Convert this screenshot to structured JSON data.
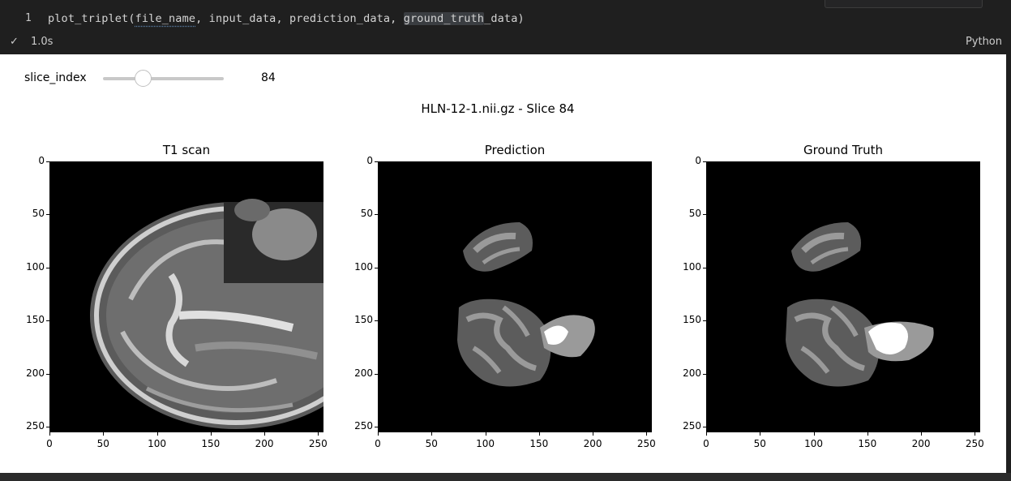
{
  "cell": {
    "line_number": "1",
    "code": {
      "fn": "plot_triplet(",
      "arg1": "file_name",
      "sep1": ", input_data, prediction_data, ",
      "arg4": "ground_truth",
      "rest": "_data)"
    },
    "status_time": "1.0s",
    "language": "Python"
  },
  "slider": {
    "label": "slice_index",
    "value": 84,
    "min": 0,
    "max": 255
  },
  "figure": {
    "suptitle": "HLN-12-1.nii.gz - Slice 84",
    "panels": [
      {
        "title": "T1 scan"
      },
      {
        "title": "Prediction"
      },
      {
        "title": "Ground Truth"
      }
    ],
    "axes": {
      "y_ticks": [
        "0",
        "50",
        "100",
        "150",
        "200",
        "250"
      ],
      "x_ticks": [
        "0",
        "50",
        "100",
        "150",
        "200",
        "250"
      ],
      "x_range": [
        0,
        255
      ],
      "y_range": [
        0,
        255
      ]
    }
  },
  "colors": {
    "editor_bg": "#1f1f1f",
    "output_bg": "#ffffff",
    "image_bg": "#000000",
    "label_gray_light": "#9a9a9a",
    "label_gray_dark": "#5c5c5c",
    "label_white": "#ffffff"
  },
  "icons": {
    "status": "check-icon"
  }
}
